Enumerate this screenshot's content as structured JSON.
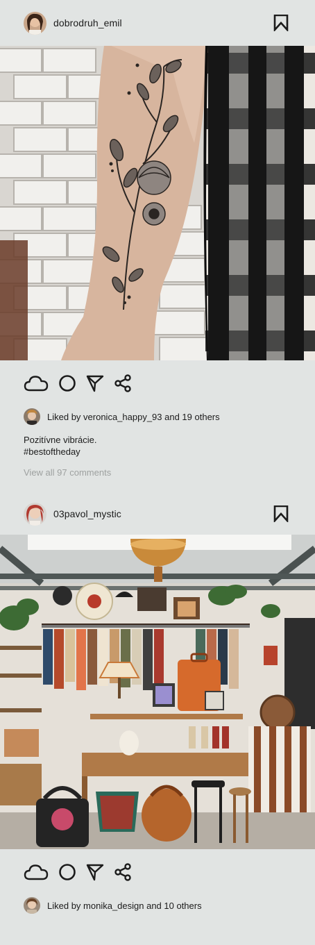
{
  "feed": {
    "posts": [
      {
        "username": "dobrodruh_emil",
        "avatar_icon": "user-avatar",
        "photo_alt": "tattoo-photo",
        "liked_by": "Liked by veronica_happy_93 and 19 others",
        "caption_line1": "Pozitívne vibrácie.",
        "caption_line2": "#bestoftheday",
        "comments_link": "View all 97 comments"
      },
      {
        "username": "03pavol_mystic",
        "avatar_icon": "user-avatar",
        "photo_alt": "vintage-shop-photo",
        "liked_by": "Liked by monika_design and 10 others"
      }
    ]
  },
  "icons": {
    "bookmark": "bookmark-icon",
    "like": "cloud-icon",
    "comment": "circle-icon",
    "send": "paper-plane-icon",
    "share": "share-icon"
  },
  "colors": {
    "background": "#e1e4e3",
    "text": "#1b1b1b",
    "muted": "#9ea1a0"
  }
}
